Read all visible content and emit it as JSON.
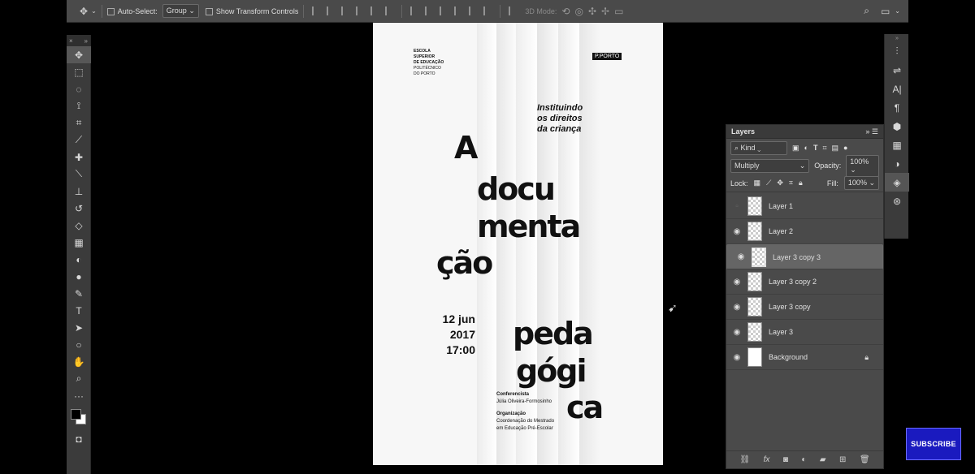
{
  "options_bar": {
    "auto_select_label": "Auto-Select:",
    "auto_select_value": "Group",
    "show_transform_label": "Show Transform Controls",
    "mode_3d_label": "3D Mode:"
  },
  "poster": {
    "school_lines": [
      "ESCOLA",
      "SUPERIOR",
      "DE EDUCAÇÃO",
      "POLITÉCNICO",
      "DO PORTO"
    ],
    "logo": "P.PORTO",
    "subtitle_lines": [
      "Instituindo",
      "os direitos",
      "da criança"
    ],
    "big_words": [
      "A",
      "docu",
      "menta",
      "ção",
      "peda",
      "gógi",
      "ca"
    ],
    "date": "12 jun",
    "year": "2017",
    "time": "17:00",
    "speaker_heading": "Conferencista",
    "speaker_name": "Júlia Oliveira-Formosinho",
    "org_heading": "Organização",
    "org_line1": "Coordenação do Mestrado",
    "org_line2": "em Educação Pré-Escolar"
  },
  "layers_panel": {
    "title": "Layers",
    "filter_kind": "Kind",
    "blend_mode": "Multiply",
    "opacity_label": "Opacity:",
    "opacity_value": "100%",
    "lock_label": "Lock:",
    "fill_label": "Fill:",
    "fill_value": "100%",
    "layers": [
      {
        "name": "Layer 1",
        "visible": false,
        "selected": false
      },
      {
        "name": "Layer 2",
        "visible": true,
        "selected": false
      },
      {
        "name": "Layer 3 copy 3",
        "visible": true,
        "selected": true
      },
      {
        "name": "Layer 3 copy 2",
        "visible": true,
        "selected": false
      },
      {
        "name": "Layer 3 copy",
        "visible": true,
        "selected": false
      },
      {
        "name": "Layer 3",
        "visible": true,
        "selected": false
      },
      {
        "name": "Background",
        "visible": true,
        "selected": false,
        "locked": true
      }
    ]
  },
  "subscribe_label": "SUBSCRIBE",
  "colors": {
    "panel": "#4a4a4a",
    "selected_layer": "#656565",
    "subscribe": "#1a1abf"
  }
}
